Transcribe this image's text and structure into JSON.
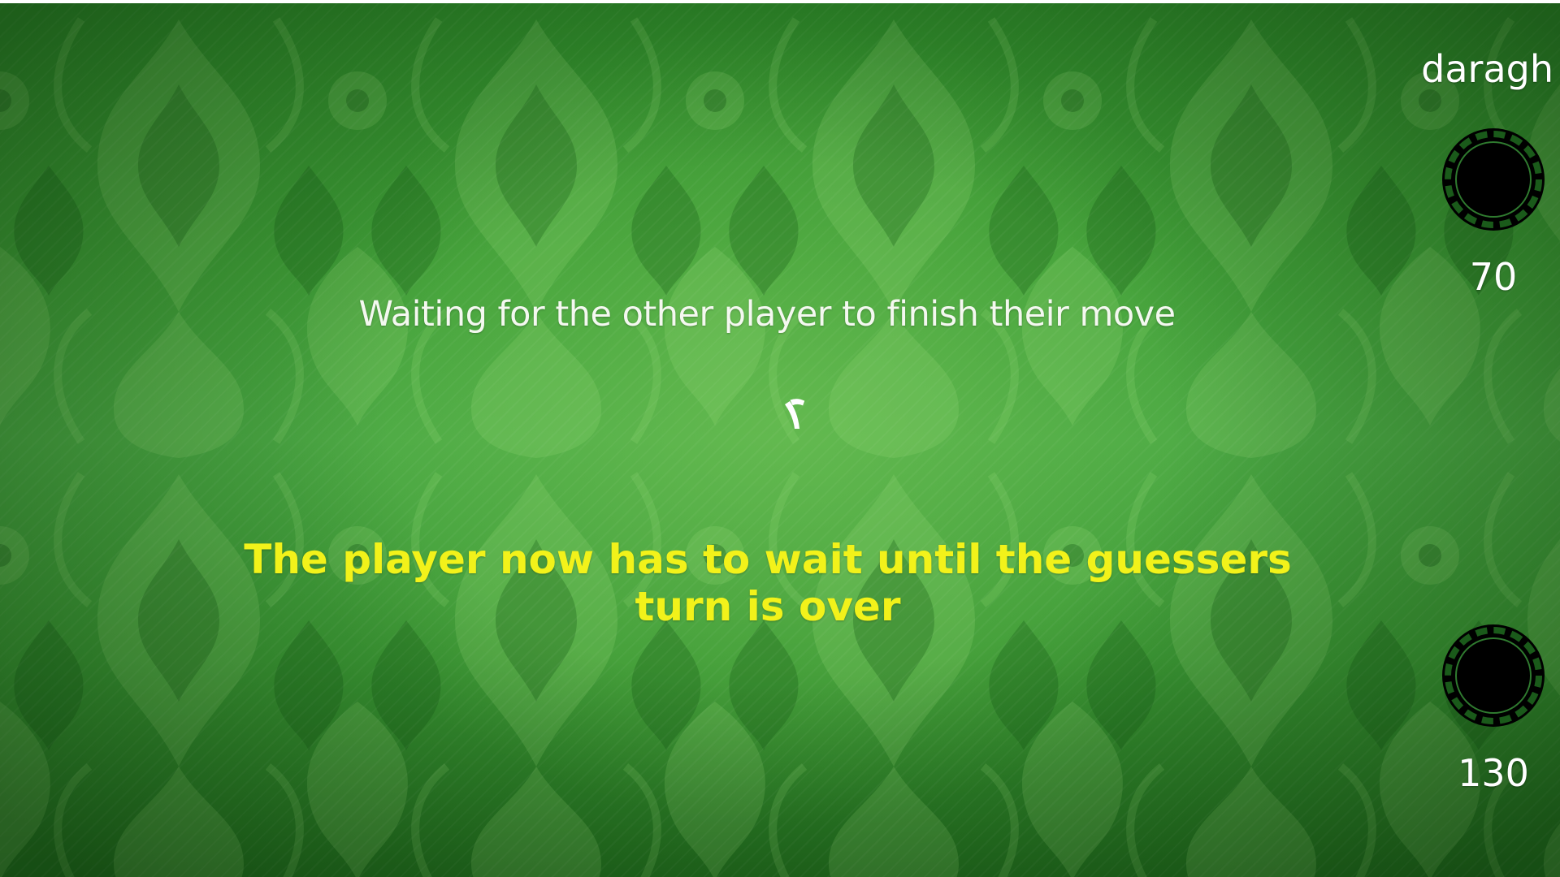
{
  "game": {
    "status_text": "Waiting for the other player to finish their move",
    "hint_text": "The player now has to wait until the guessers turn is over",
    "player_name": "daragh",
    "chips": [
      {
        "value": "70"
      },
      {
        "value": "130"
      }
    ]
  },
  "colors": {
    "background_green": "#3f9e37",
    "hint_yellow": "#f2f21a",
    "text_white": "#ffffff",
    "chip_black": "#000000"
  },
  "icons": {
    "spinner": "loading-spinner-icon",
    "chip": "poker-chip-icon"
  }
}
